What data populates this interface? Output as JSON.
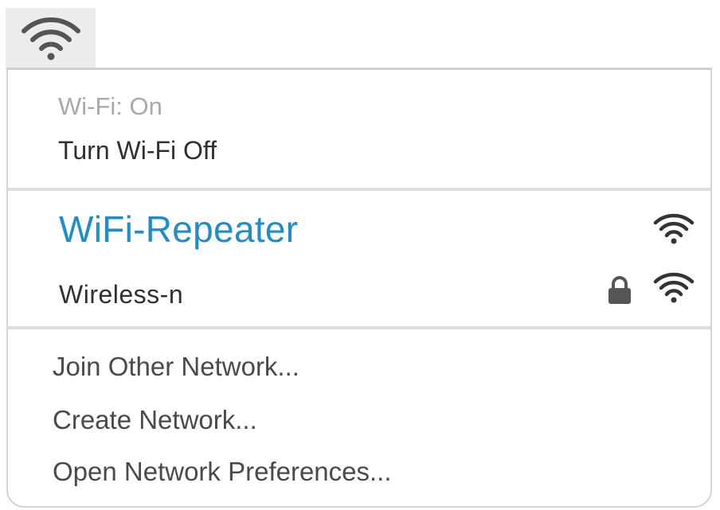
{
  "menubar": {
    "icon": "wifi-icon"
  },
  "wifi_menu": {
    "status": "Wi-Fi: On",
    "toggle_label": "Turn Wi-Fi Off",
    "networks": [
      {
        "name": "WiFi-Repeater",
        "connected": true,
        "secured": false,
        "signal_icon": "wifi-signal-icon"
      },
      {
        "name": "Wireless-n",
        "connected": false,
        "secured": true,
        "lock_icon": "lock-icon",
        "signal_icon": "wifi-signal-icon"
      }
    ],
    "actions": {
      "join_other": "Join Other Network...",
      "create": "Create Network...",
      "preferences": "Open Network Preferences..."
    }
  },
  "colors": {
    "connected_network": "#1f8ec8",
    "menubar_highlight": "#ececec",
    "separator": "#dedede"
  }
}
